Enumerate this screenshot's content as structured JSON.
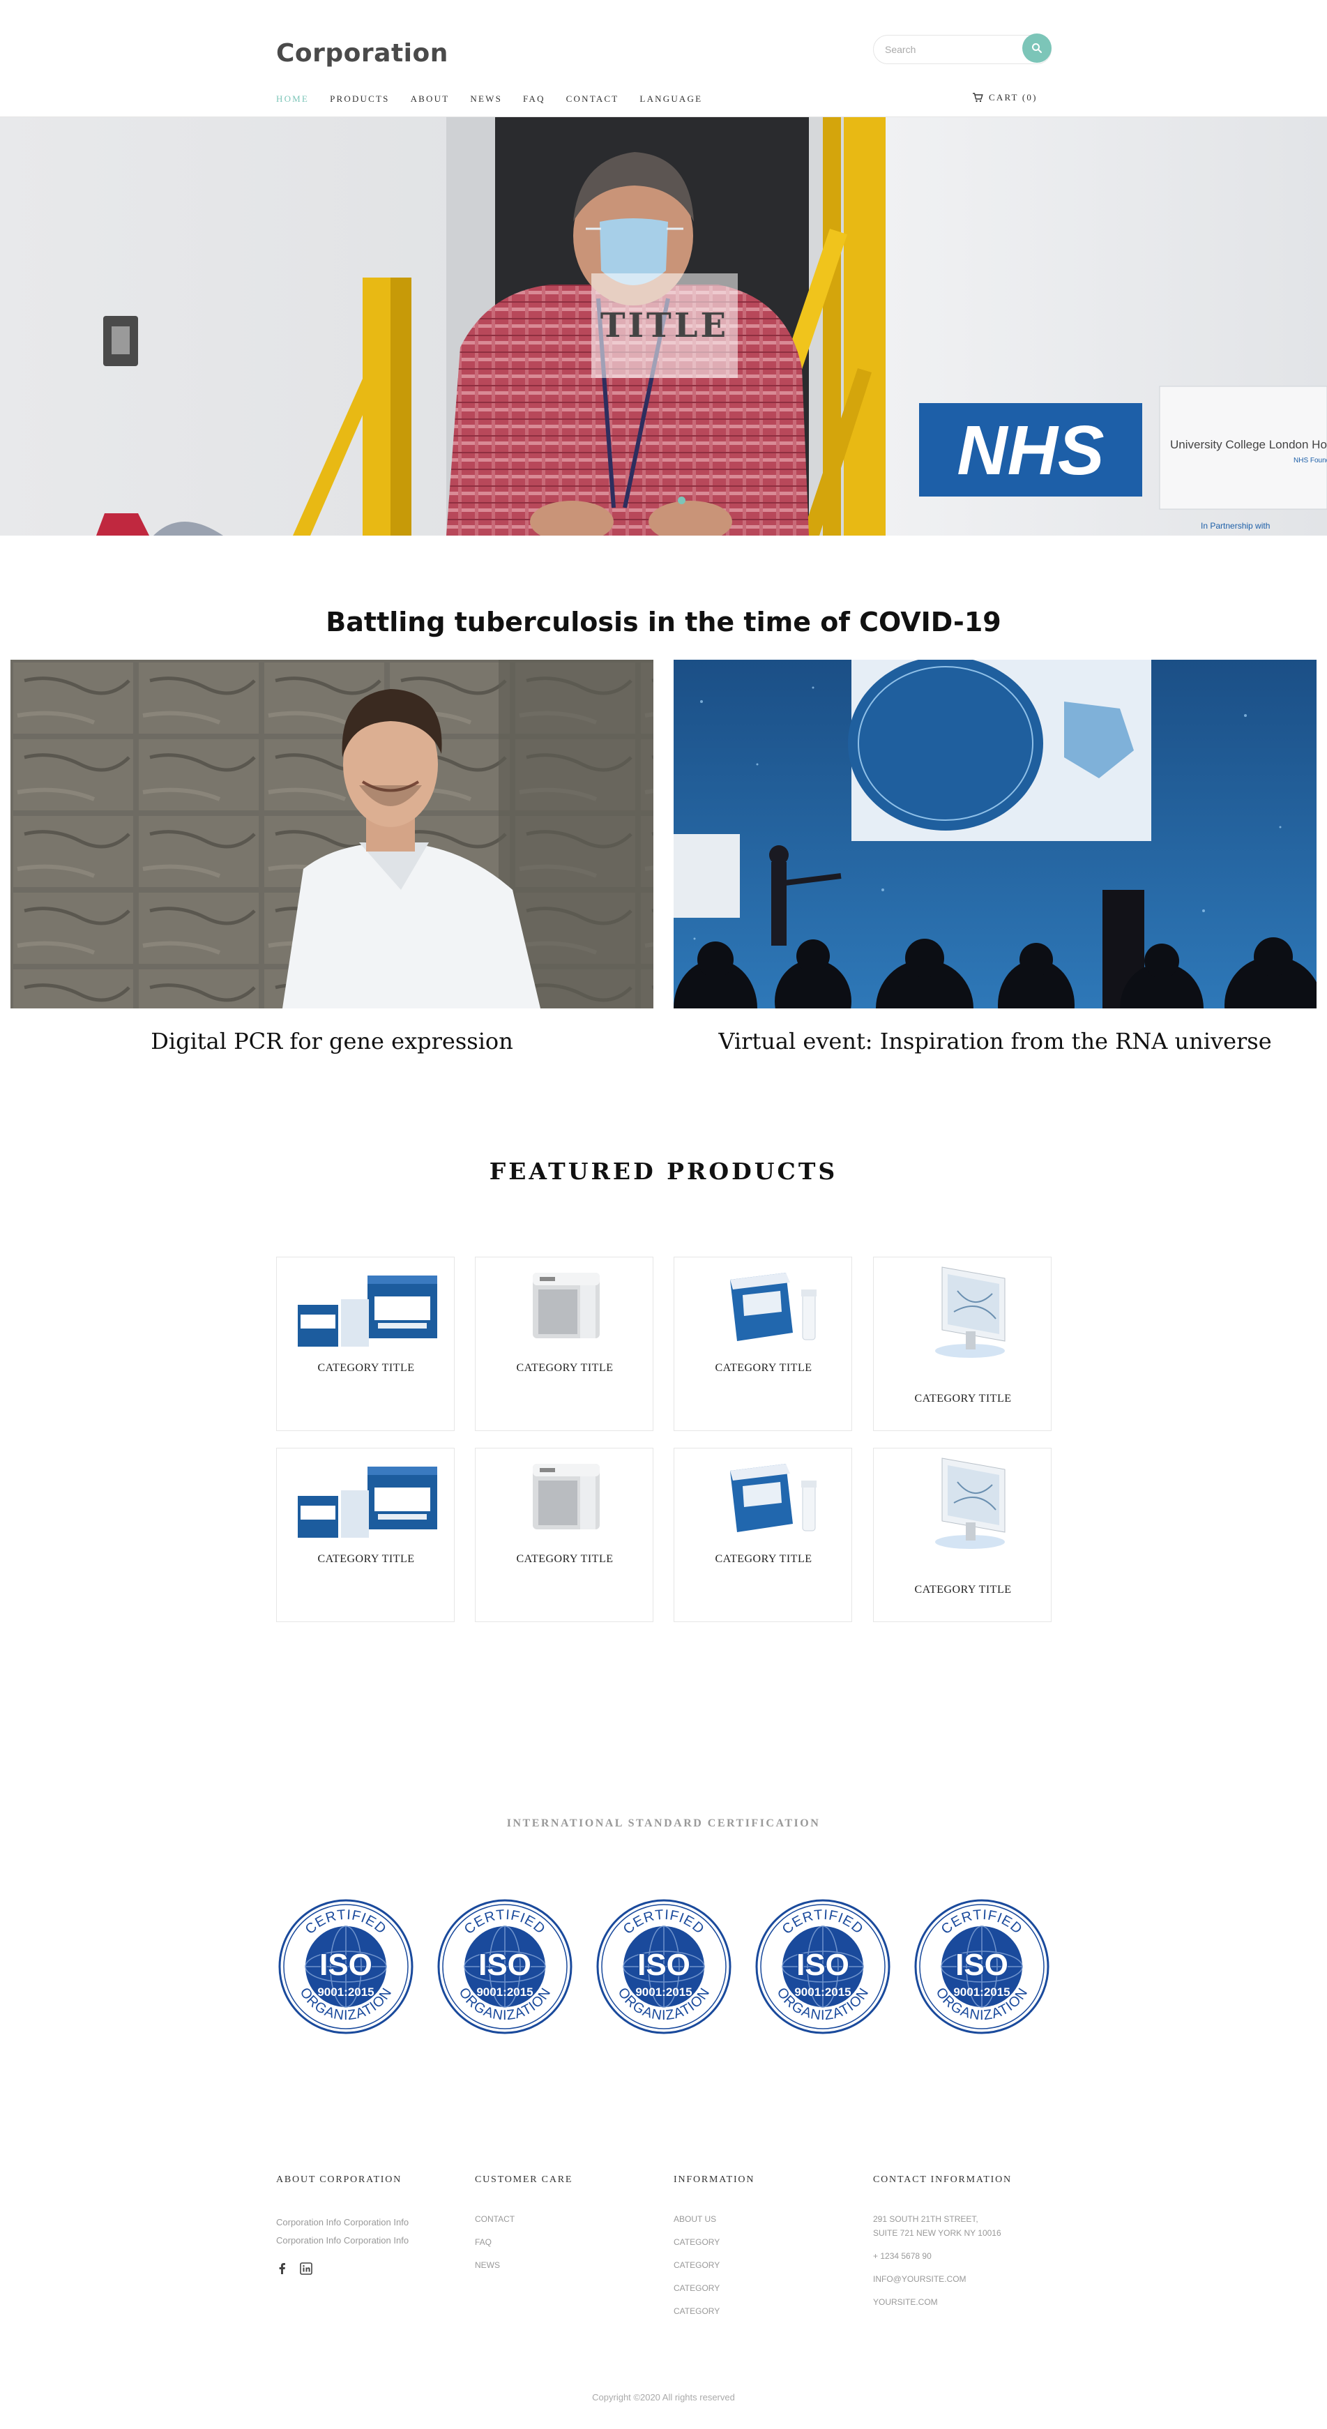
{
  "brand": {
    "logo": "Corporation",
    "accent": "#7cc5b8"
  },
  "search": {
    "placeholder": "Search"
  },
  "nav": [
    {
      "label": "HOME",
      "active": true
    },
    {
      "label": "PRODUCTS"
    },
    {
      "label": "ABOUT"
    },
    {
      "label": "NEWS"
    },
    {
      "label": "FAQ"
    },
    {
      "label": "CONTACT"
    },
    {
      "label": "LANGUAGE"
    }
  ],
  "cart": {
    "label": "CART (0)",
    "icon": "cart-icon"
  },
  "hero": {
    "title": "TITLE",
    "sign_text": "NHS",
    "sign_subtext": "University College London Ho",
    "sign_subtext2": "NHS Founda",
    "sign_subtext3": "In Partnership with"
  },
  "articles": {
    "heading": "Battling tuberculosis in the time of COVID-19",
    "items": [
      {
        "title": "Digital PCR for gene expression"
      },
      {
        "title": "Virtual event: Inspiration from the RNA universe"
      }
    ]
  },
  "featured": {
    "heading": "FEATURED PRODUCTS",
    "cards": [
      {
        "label": "CATEGORY TITLE",
        "icon": "kit-boxes-icon"
      },
      {
        "label": "CATEGORY TITLE",
        "icon": "instrument-icon"
      },
      {
        "label": "CATEGORY TITLE",
        "icon": "kit-tube-icon"
      },
      {
        "label": "CATEGORY TITLE",
        "icon": "monitor-icon"
      },
      {
        "label": "CATEGORY TITLE",
        "icon": "kit-boxes-icon"
      },
      {
        "label": "CATEGORY TITLE",
        "icon": "instrument-icon"
      },
      {
        "label": "CATEGORY TITLE",
        "icon": "kit-tube-icon"
      },
      {
        "label": "CATEGORY TITLE",
        "icon": "monitor-icon"
      }
    ]
  },
  "certification": {
    "heading": "INTERNATIONAL STANDARD CERTIFICATION",
    "badge": {
      "top": "CERTIFIED",
      "mark": "ISO",
      "standard": "9001:2015",
      "bottom": "ORGANIZATION",
      "color": "#1a4a9c"
    },
    "count": 5
  },
  "footer": {
    "about": {
      "heading": "ABOUT CORPORATION",
      "lines": [
        "Corporation Info Corporation Info",
        "Corporation Info Corporation Info"
      ]
    },
    "customer_care": {
      "heading": "CUSTOMER CARE",
      "links": [
        "CONTACT",
        "FAQ",
        "NEWS"
      ]
    },
    "information": {
      "heading": "INFORMATION",
      "links": [
        "ABOUT US",
        "CATEGORY",
        "CATEGORY",
        "CATEGORY",
        "CATEGORY"
      ]
    },
    "contact": {
      "heading": "CONTACT INFORMATION",
      "address1": "291 SOUTH 21TH STREET,",
      "address2": "SUITE 721 NEW YORK NY 10016",
      "phone": "+ 1234 5678 90",
      "email": "INFO@YOURSITE.COM",
      "site": "YOURSITE.COM"
    },
    "copyright": "Copyright ©2020 All rights reserved"
  }
}
